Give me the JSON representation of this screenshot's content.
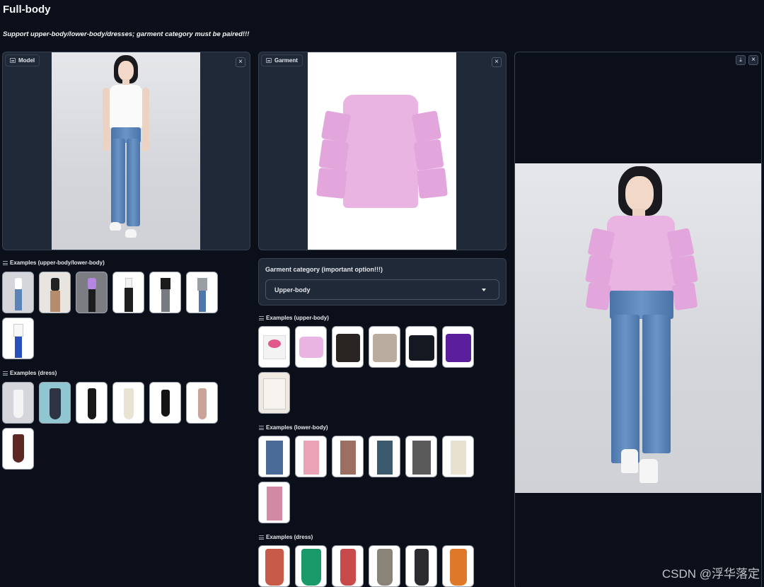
{
  "page": {
    "title": "Full-body",
    "subtitle": "Support upper-body/lower-body/dresses; garment category must be paired!!!"
  },
  "model_panel": {
    "label": "Model",
    "close_icon": "close-icon"
  },
  "garment_panel": {
    "label": "Garment",
    "close_icon": "close-icon"
  },
  "result_panel": {
    "download_icon": "download-icon",
    "close_icon": "close-icon"
  },
  "model_examples": [
    {
      "label": "Examples (upper-body/lower-body)",
      "count": 7
    },
    {
      "label": "Examples (dress)",
      "count": 7
    }
  ],
  "category": {
    "label": "Garment category (important option!!!)",
    "selected": "Upper-body"
  },
  "garment_examples": [
    {
      "label": "Examples (upper-body)",
      "count": 7
    },
    {
      "label": "Examples (lower-body)",
      "count": 7
    },
    {
      "label": "Examples (dress)",
      "count": 6
    }
  ],
  "watermark": "CSDN @浮华落定",
  "colors": {
    "background": "#0b0f19",
    "panel": "#1f2937",
    "border": "#374151",
    "blouse_pink": "#e9b4e2",
    "denim": "#5a84b8"
  }
}
